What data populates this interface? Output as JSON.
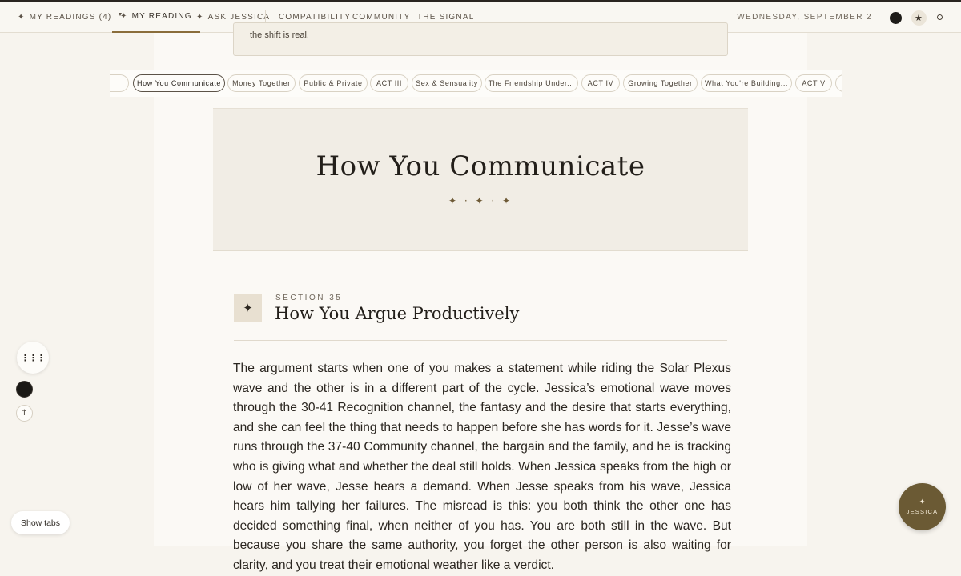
{
  "nav": {
    "my_readings": "MY READINGS (4)",
    "my_reading": "MY READING",
    "ask_jessica": "ASK JESSICA",
    "compatibility": "COMPATIBILITY",
    "community": "COMMUNITY",
    "the_signal": "THE SIGNAL",
    "date": "WEDNESDAY, SEPTEMBER 2",
    "star_glyph": "✦",
    "caret_glyph": "▼"
  },
  "callout": {
    "text": "the shift is real."
  },
  "tabs": [
    {
      "label": "How You Communicate",
      "active": true
    },
    {
      "label": "Money Together"
    },
    {
      "label": "Public & Private"
    },
    {
      "label": "ACT III"
    },
    {
      "label": "Sex & Sensuality"
    },
    {
      "label": "The Friendship Under..."
    },
    {
      "label": "ACT IV"
    },
    {
      "label": "Growing Together"
    },
    {
      "label": "What You're Building..."
    },
    {
      "label": "ACT V"
    }
  ],
  "chapter": {
    "title": "How You Communicate",
    "ornament": "✦ · ✦ · ✦"
  },
  "section": {
    "badge_glyph": "✦",
    "label": "SECTION 35",
    "title": "How You Argue Productively",
    "body": "The argument starts when one of you makes a statement while riding the Solar Plexus wave and the other is in a different part of the cycle. Jessica’s emotional wave moves through the 30-41 Recognition channel, the fantasy and the desire that starts everything, and she can feel the thing that needs to happen before she has words for it. Jesse’s wave runs through the 37-40 Community channel, the bargain and the family, and he is tracking who is giving what and whether the deal still holds. When Jessica speaks from the high or low of her wave, Jesse hears a demand. When Jesse speaks from his wave, Jessica hears him tallying her failures. The misread is this: you both think the other one has decided something final, when neither of you has. You are both still in the wave. But because you share the same authority, you forget the other person is also waiting for clarity, and you treat their emotional weather like a verdict."
  },
  "controls": {
    "dots_glyph": "⋮⋮⋮",
    "up_glyph": "↑",
    "show_tabs": "Show tabs",
    "jessica_star": "✦",
    "jessica_label": "JESSICA"
  }
}
